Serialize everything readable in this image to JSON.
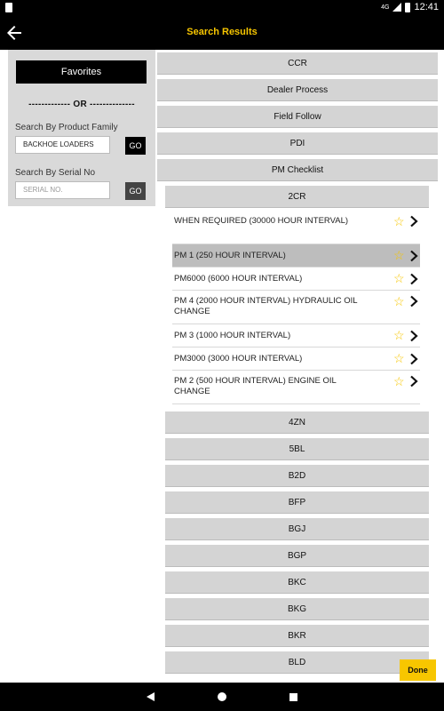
{
  "status_bar": {
    "network": "4G",
    "time": "12:41"
  },
  "app_bar": {
    "title": "Search Results",
    "back_icon": "arrow-left-icon"
  },
  "left_panel": {
    "favorites_label": "Favorites",
    "or_divider": "------------- OR --------------",
    "product_family_label": "Search By Product Family",
    "product_family_value": "BACKHOE LOADERS",
    "product_family_go": "GO",
    "serial_label": "Search By Serial No",
    "serial_placeholder": "SERIAL NO.",
    "serial_go": "GO"
  },
  "results": {
    "top_categories": [
      "CCR",
      "Dealer Process",
      "Field Follow",
      "PDI",
      "PM Checklist"
    ],
    "open_model": "2CR",
    "checklist_items": [
      {
        "text": "WHEN REQUIRED (30000 HOUR INTERVAL)",
        "selected": false
      },
      {
        "text": "PM 1 (250 HOUR INTERVAL)",
        "selected": true
      },
      {
        "text": "PM6000 (6000 HOUR INTERVAL)",
        "selected": false
      },
      {
        "text": "PM 4 (2000 HOUR INTERVAL) HYDRAULIC OIL CHANGE",
        "selected": false
      },
      {
        "text": "PM 3 (1000 HOUR INTERVAL)",
        "selected": false
      },
      {
        "text": "PM3000 (3000 HOUR INTERVAL)",
        "selected": false
      },
      {
        "text": "PM 2 (500 HOUR INTERVAL) ENGINE OIL CHANGE",
        "selected": false
      }
    ],
    "other_models": [
      "4ZN",
      "5BL",
      "B2D",
      "BFP",
      "BGJ",
      "BGP",
      "BKC",
      "BKG",
      "BKR",
      "BLD"
    ]
  },
  "done_label": "Done",
  "colors": {
    "accent": "#f7c600",
    "bar": "#000000",
    "panel": "#d9d9d9",
    "row": "#d4d4d4",
    "selected": "#bdbdbd"
  },
  "icons": {
    "favorite": "star-outline-icon",
    "open": "chevron-right-icon"
  }
}
